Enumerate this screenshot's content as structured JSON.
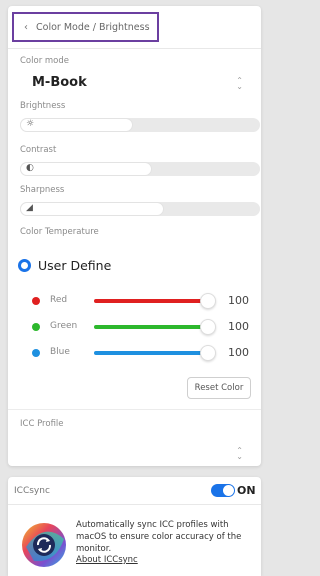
{
  "header": {
    "back_icon": "chevron-left-icon",
    "title": "Color Mode / Brightness"
  },
  "color_mode": {
    "label": "Color mode",
    "value": "M-Book"
  },
  "brightness": {
    "label": "Brightness",
    "icon": "sun-icon",
    "level": 0.47
  },
  "contrast": {
    "label": "Contrast",
    "icon": "contrast-icon",
    "level": 0.55
  },
  "sharpness": {
    "label": "Sharpness",
    "icon": "sharpness-icon",
    "level": 0.6
  },
  "color_temperature": {
    "label": "Color Temperature",
    "selected_option": "User Define",
    "channels": [
      {
        "name": "Red",
        "value": "100",
        "color": "#e02020"
      },
      {
        "name": "Green",
        "value": "100",
        "color": "#2db82d"
      },
      {
        "name": "Blue",
        "value": "100",
        "color": "#1e90e0"
      }
    ],
    "reset_label": "Reset Color"
  },
  "icc_profile": {
    "label": "ICC Profile"
  },
  "iccsync": {
    "title": "ICCsync",
    "toggle_state": "ON",
    "description": "Automatically sync ICC profiles with macOS to ensure color accuracy of the monitor.",
    "link": "About ICCsync"
  },
  "colors": {
    "accent": "#1a73e8",
    "highlight_border": "#6b3fa0"
  }
}
